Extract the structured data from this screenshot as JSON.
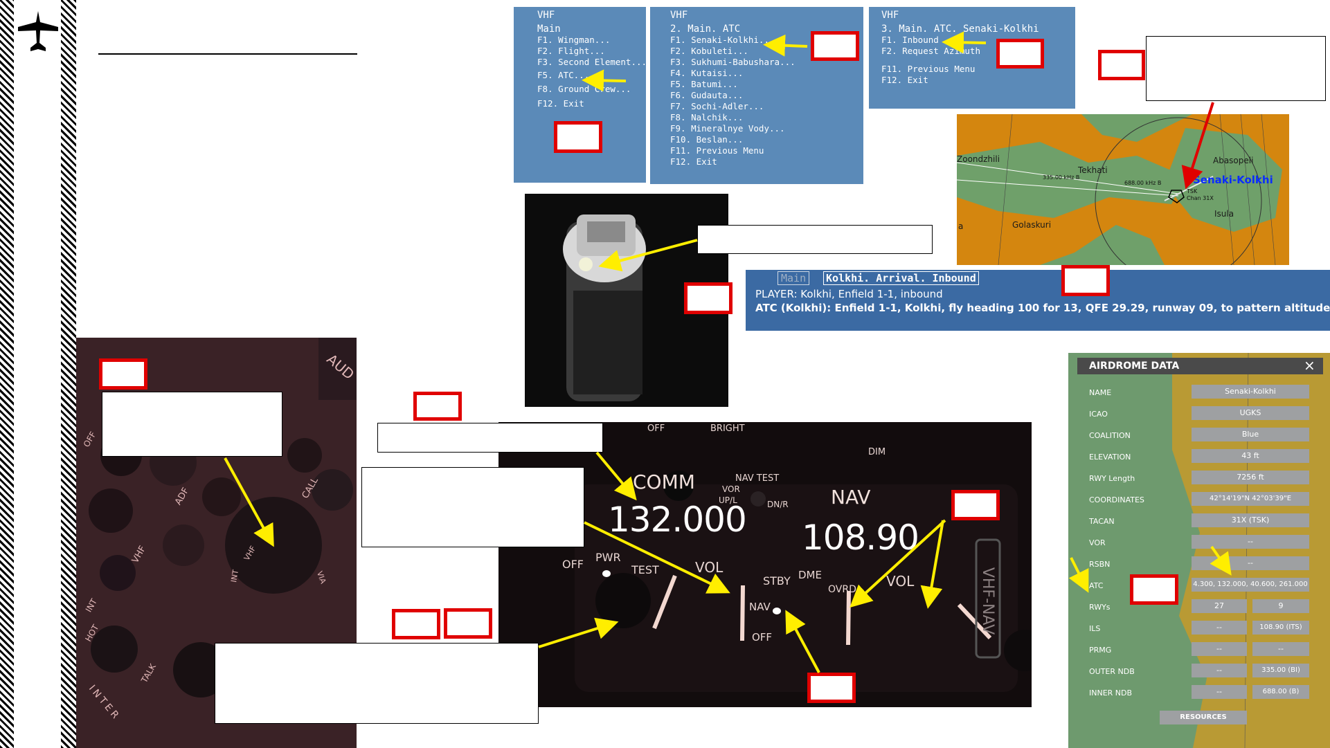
{
  "menus": {
    "vhf_main": {
      "radio": "VHF",
      "title": "Main",
      "items": [
        "F1. Wingman...",
        "F2. Flight...",
        "F3. Second Element...",
        "F5. ATC...",
        "F8. Ground Crew...",
        "F12. Exit"
      ]
    },
    "atc": {
      "radio": "VHF",
      "title": "2. Main. ATC",
      "items": [
        "F1. Senaki-Kolkhi...",
        "F2. Kobuleti...",
        "F3. Sukhumi-Babushara...",
        "F4. Kutaisi...",
        "F5. Batumi...",
        "F6. Gudauta...",
        "F7. Sochi-Adler...",
        "F8. Nalchik...",
        "F9. Mineralnye Vody...",
        "F10. Beslan...",
        "F11. Previous Menu",
        "F12. Exit"
      ]
    },
    "senaki": {
      "radio": "VHF",
      "title": "3. Main. ATC. Senaki-Kolkhi",
      "items": [
        "F1. Inbound",
        "F2. Request Azimuth",
        "F11. Previous Menu",
        "F12. Exit"
      ]
    }
  },
  "map": {
    "labels": [
      "Zoondzhili",
      "Tekhati",
      "Abasopeli",
      "Golaskuri",
      "Isula",
      "a"
    ],
    "airfield": "Senaki-Kolkhi",
    "freq_labels": [
      "335.00 kHz B",
      "688.00 kHz B"
    ],
    "tacan": "TSK",
    "chan": "Chan 31X"
  },
  "chat": {
    "tab_main": "Main",
    "tab_active": "Kolkhi. Arrival. Inbound",
    "line1": "PLAYER: Kolkhi, Enfield 1-1, inbound",
    "line2": "ATC (Kolkhi): Enfield 1-1, Kolkhi, fly heading 100 for 13, QFE 29.29, runway 09, to pattern altitude"
  },
  "comm_panel": {
    "off_bright": "OFF",
    "bright": "BRIGHT",
    "dim": "DIM",
    "comm": "COMM",
    "comm_freq": "132.000",
    "nav": "NAV",
    "nav_freq": "108.90",
    "nav_test": "NAV TEST",
    "vor": "VOR",
    "upl": "UP/L",
    "dnr": "DN/R",
    "off_pwr": "OFF",
    "pwr": "PWR",
    "test": "TEST",
    "vol": "VOL",
    "stby": "STBY",
    "dme": "DME",
    "ovrd": "OVRD",
    "nav_sw": "NAV",
    "off_sw": "OFF",
    "vol2": "VOL",
    "vhf_nav": "VHF-NAV"
  },
  "audio_panel": {
    "labels": [
      "AUD",
      "OFF",
      "CALL",
      "ADF",
      "VHF",
      "INT",
      "VHF",
      "HOT",
      "INT",
      "TALK",
      "INTER",
      "VIA"
    ]
  },
  "airdrome": {
    "header": "AIRDROME DATA",
    "rows": [
      {
        "label": "NAME",
        "value": "Senaki-Kolkhi"
      },
      {
        "label": "ICAO",
        "value": "UGKS"
      },
      {
        "label": "COALITION",
        "value": "Blue"
      },
      {
        "label": "ELEVATION",
        "value": "43 ft"
      },
      {
        "label": "RWY Length",
        "value": "7256 ft"
      },
      {
        "label": "COORDINATES",
        "value": "42°14'19\"N 42°03'39\"E"
      },
      {
        "label": "TACAN",
        "value": "31X (TSK)"
      },
      {
        "label": "VOR",
        "value": "--"
      },
      {
        "label": "RSBN",
        "value": "--"
      },
      {
        "label": "ATC",
        "value": "4.300, 132.000, 40.600, 261.000"
      }
    ],
    "split_rows": [
      {
        "label": "RWYs",
        "left": "27",
        "right": "9"
      },
      {
        "label": "ILS",
        "left": "--",
        "right": "108.90 (ITS)"
      },
      {
        "label": "PRMG",
        "left": "--",
        "right": "--"
      },
      {
        "label": "OUTER NDB",
        "left": "--",
        "right": "335.00 (BI)"
      },
      {
        "label": "INNER NDB",
        "left": "--",
        "right": "688.00 (B)"
      }
    ],
    "resources": "RESOURCES",
    "close": "×"
  },
  "colors": {
    "menu_bg": "#5b8ab8",
    "callout_red": "#e00000",
    "arrow_yellow": "#ffee00",
    "airdrome_bg": "#6e9a6e",
    "airdrome_header": "#4a4a4a",
    "chat_bg": "#3b6aa3",
    "map_orange": "#d4860f",
    "map_green": "#6fa06a",
    "label_blue": "#0a2cff"
  },
  "icons": {
    "sidebar": "aircraft-icon"
  }
}
